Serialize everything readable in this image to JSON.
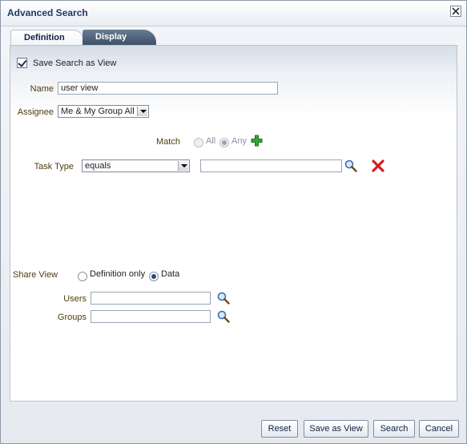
{
  "dialog": {
    "title": "Advanced Search"
  },
  "tabs": [
    {
      "label": "Definition",
      "selected": true
    },
    {
      "label": "Display",
      "selected": false
    }
  ],
  "form": {
    "save_as_view": {
      "label": "Save Search as View",
      "checked": true
    },
    "name": {
      "label": "Name",
      "value": "user view"
    },
    "assignee": {
      "label": "Assignee",
      "value": "Me & My Group All"
    },
    "match": {
      "label": "Match",
      "options": [
        {
          "label": "All",
          "selected": false
        },
        {
          "label": "Any",
          "selected": true
        }
      ]
    },
    "condition": {
      "label": "Task Type",
      "operator": "equals",
      "value": ""
    },
    "share_view": {
      "label": "Share View",
      "options": [
        {
          "label": "Definition only",
          "selected": false
        },
        {
          "label": "Data",
          "selected": true
        }
      ]
    },
    "users": {
      "label": "Users",
      "value": ""
    },
    "groups": {
      "label": "Groups",
      "value": ""
    }
  },
  "buttons": {
    "reset": "Reset",
    "save_view": "Save as View",
    "search": "Search",
    "cancel": "Cancel"
  },
  "colors": {
    "label_text": "#4b3d0d",
    "title_text": "#1e3a63",
    "add_icon": "#2fa82f",
    "remove_icon": "#d01e1e",
    "search_icon": "#3a6fb0"
  }
}
